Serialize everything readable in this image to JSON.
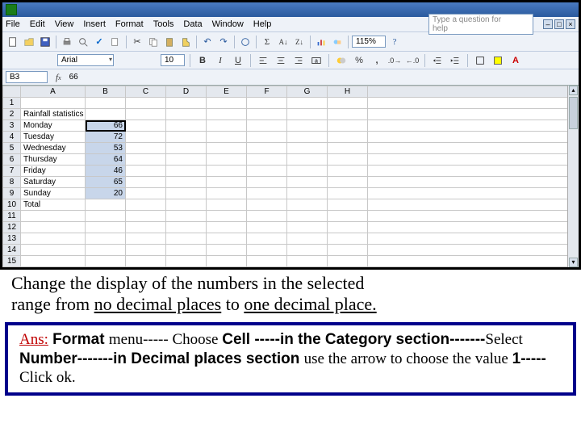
{
  "menubar": {
    "items": [
      "File",
      "Edit",
      "View",
      "Insert",
      "Format",
      "Tools",
      "Data",
      "Window",
      "Help"
    ],
    "help_placeholder": "Type a question for help"
  },
  "toolbar": {
    "zoom": "115%"
  },
  "format": {
    "font_name": "Arial",
    "font_size": "10",
    "bold": "B",
    "italic": "I",
    "underline": "U"
  },
  "namebox": {
    "ref": "B3",
    "fx_value": "66"
  },
  "columns": [
    "A",
    "B",
    "C",
    "D",
    "E",
    "F",
    "G",
    "H"
  ],
  "row_headers": [
    "1",
    "2",
    "3",
    "4",
    "5",
    "6",
    "7",
    "8",
    "9",
    "10",
    "11",
    "12",
    "13",
    "14",
    "15"
  ],
  "cells": {
    "title": "Rainfall statistics",
    "days": [
      "Monday",
      "Tuesday",
      "Wednesday",
      "Thursday",
      "Friday",
      "Saturday",
      "Sunday"
    ],
    "values": [
      "66",
      "72",
      "53",
      "64",
      "46",
      "65",
      "20"
    ],
    "total_label": "Total"
  },
  "caption": {
    "line1": "Change the display of the numbers in the selected",
    "line2_pre": "range from ",
    "line2_u1": "no decimal places",
    "line2_mid": " to ",
    "line2_u2": "one decimal place."
  },
  "answer": {
    "label": "Ans:",
    "t1": " Format ",
    "t2": "menu----- ",
    "t3": "Choose ",
    "t4": "Cell -----in the Category section-------",
    "t5": "Select ",
    "t6": "Number-------in Decimal places section ",
    "t7": "use the arrow to choose the value ",
    "t8": "1-----",
    "t9": "Click ok."
  }
}
